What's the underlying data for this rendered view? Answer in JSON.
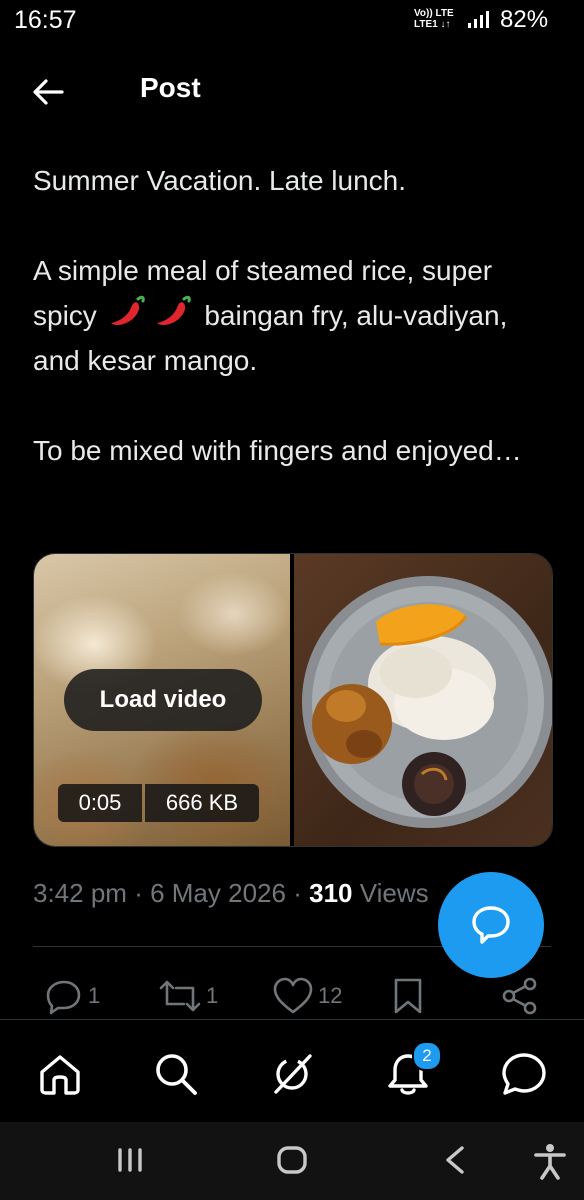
{
  "status_bar": {
    "time": "16:57",
    "network_top": "Vo)) LTE",
    "network_bottom": "LTE1 ↓↑",
    "battery": "82%"
  },
  "header": {
    "title": "Post"
  },
  "post": {
    "line1": "Summer Vacation. Late lunch.",
    "line2_before": "A simple meal of steamed rice, super spicy",
    "line2_after": "baingan fry, alu-vadiyan, and kesar mango.",
    "line3": "To be mixed with fingers and enjoyed…",
    "time": "3:42 pm",
    "date": "6 May 2026",
    "separator": "·",
    "views_count": "310",
    "views_label": "Views"
  },
  "media": {
    "load_button": "Load video",
    "duration": "0:05",
    "size": "666 KB"
  },
  "actions": {
    "replies": "1",
    "reposts": "1",
    "likes": "12"
  },
  "nav": {
    "notification_badge": "2"
  },
  "colors": {
    "accent": "#1d9bf0",
    "background": "#000000",
    "text": "#e7e9ea",
    "muted": "#71767b"
  }
}
